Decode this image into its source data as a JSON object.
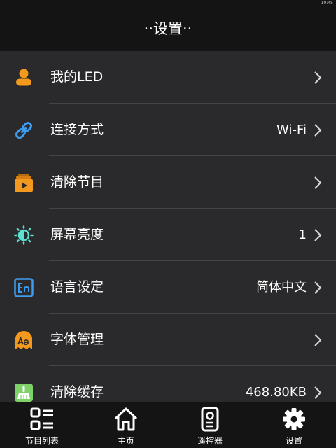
{
  "status_bar": {
    "time": "10:45"
  },
  "header": {
    "title": "··设置··"
  },
  "settings": {
    "items": [
      {
        "label": "我的LED",
        "value": "",
        "icon": "user-icon",
        "color": "#f39a1e"
      },
      {
        "label": "连接方式",
        "value": "Wi-Fi",
        "icon": "link-icon",
        "color": "#3e9cf0"
      },
      {
        "label": "清除节目",
        "value": "",
        "icon": "clear-program-icon",
        "color": "#f39a1e"
      },
      {
        "label": "屏幕亮度",
        "value": "1",
        "icon": "brightness-icon",
        "color": "#5ce0d0"
      },
      {
        "label": "语言设定",
        "value": "简体中文",
        "icon": "language-en-icon",
        "color": "#3e9cf0"
      },
      {
        "label": "字体管理",
        "value": "",
        "icon": "font-aa-icon",
        "color": "#f39a1e"
      },
      {
        "label": "清除缓存",
        "value": "468.80KB",
        "icon": "broom-icon",
        "color": "#7fd16a"
      }
    ]
  },
  "tabbar": {
    "tabs": [
      {
        "label": "节目列表",
        "icon": "program-list-icon"
      },
      {
        "label": "主页",
        "icon": "home-icon"
      },
      {
        "label": "遥控器",
        "icon": "remote-icon"
      },
      {
        "label": "设置",
        "icon": "gear-icon"
      }
    ],
    "active_index": 3
  }
}
